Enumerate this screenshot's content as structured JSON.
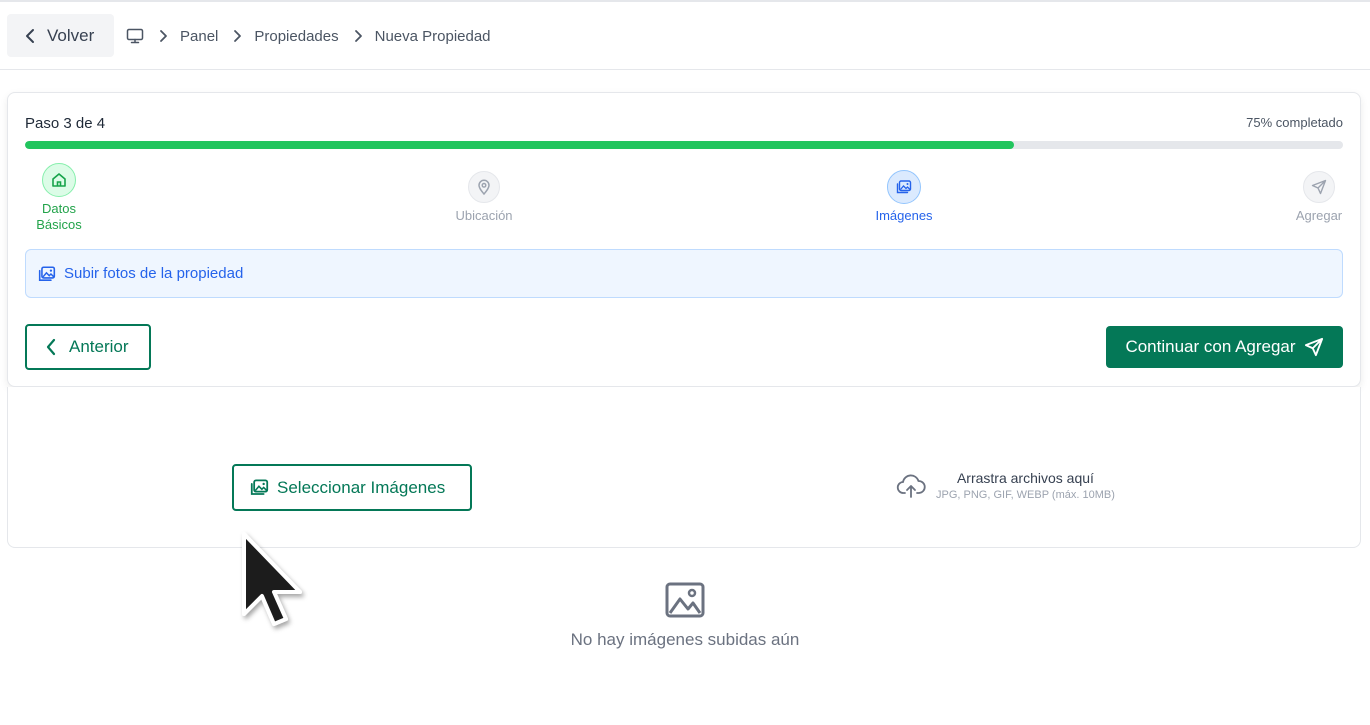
{
  "header": {
    "back_label": "Volver",
    "breadcrumb": [
      "Panel",
      "Propiedades",
      "Nueva Propiedad"
    ]
  },
  "wizard": {
    "step_text": "Paso 3 de 4",
    "progress_text": "75% completado",
    "progress_fraction": 0.75,
    "steps": [
      {
        "label": "Datos\nBásicos",
        "icon": "home-icon",
        "state": "completed"
      },
      {
        "label": "Ubicación",
        "icon": "map-pin-icon",
        "state": "pending"
      },
      {
        "label": "Imágenes",
        "icon": "image-icon",
        "state": "active"
      },
      {
        "label": "Agregar",
        "icon": "send-icon",
        "state": "pending"
      }
    ],
    "info_text": "Subir fotos de la propiedad",
    "prev_label": "Anterior",
    "next_label": "Continuar con Agregar"
  },
  "upload": {
    "select_label": "Seleccionar Imágenes",
    "drop_title": "Arrastra archivos aquí",
    "drop_hint": "JPG, PNG, GIF, WEBP (máx. 10MB)"
  },
  "empty_state": {
    "text": "No hay imágenes subidas aún"
  },
  "colors": {
    "brand_green": "#047857",
    "progress_green": "#22c55e",
    "active_blue": "#2563eb",
    "info_bg": "#eff6ff"
  }
}
